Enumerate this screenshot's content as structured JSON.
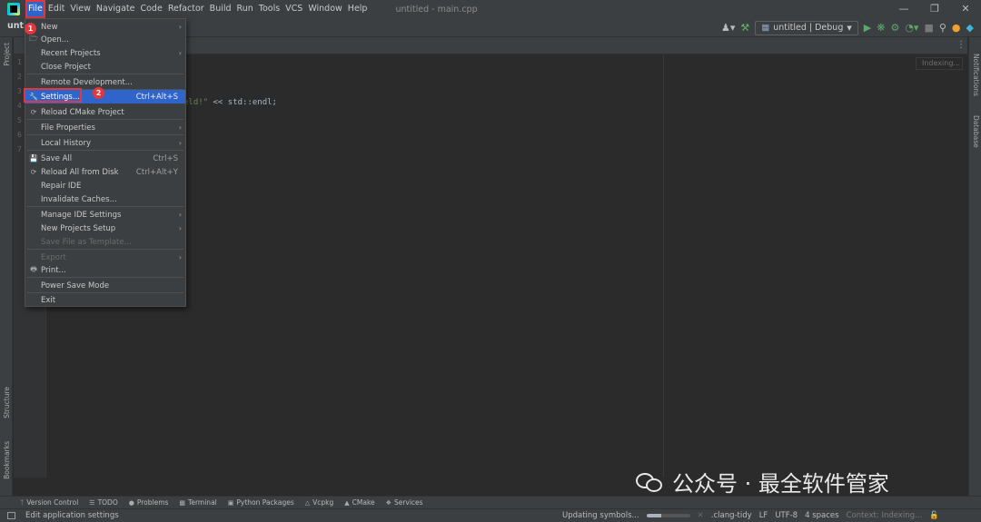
{
  "app": {
    "window_title": "untitled - main.cpp",
    "project": "untitled"
  },
  "menubar": [
    "File",
    "Edit",
    "View",
    "Navigate",
    "Code",
    "Refactor",
    "Build",
    "Run",
    "Tools",
    "VCS",
    "Window",
    "Help"
  ],
  "window_buttons": [
    "—",
    "❐",
    "✕"
  ],
  "run_config": {
    "label": "untitled | Debug"
  },
  "file_menu": {
    "items": [
      {
        "label": "New",
        "arrow": "›"
      },
      {
        "label": "Open...",
        "icon": "folder-icon"
      },
      {
        "label": "Recent Projects",
        "arrow": "›"
      },
      {
        "label": "Close Project"
      },
      {
        "label": "Remote Development..."
      },
      {
        "label": "Settings...",
        "shortcut": "Ctrl+Alt+S",
        "icon": "wrench-icon",
        "highlight": true
      },
      {
        "label": "Reload CMake Project",
        "icon": "reload-icon"
      },
      {
        "label": "File Properties",
        "arrow": "›"
      },
      {
        "label": "Local History",
        "arrow": "›"
      },
      {
        "label": "Save All",
        "shortcut": "Ctrl+S",
        "icon": "save-icon"
      },
      {
        "label": "Reload All from Disk",
        "shortcut": "Ctrl+Alt+Y",
        "icon": "reload-icon"
      },
      {
        "label": "Repair IDE"
      },
      {
        "label": "Invalidate Caches..."
      },
      {
        "label": "Manage IDE Settings",
        "arrow": "›"
      },
      {
        "label": "New Projects Setup",
        "arrow": "›"
      },
      {
        "label": "Save File as Template...",
        "disabled": true
      },
      {
        "label": "Export",
        "arrow": "›",
        "disabled": true
      },
      {
        "label": "Print...",
        "icon": "print-icon"
      },
      {
        "label": "Power Save Mode"
      },
      {
        "label": "Exit"
      }
    ]
  },
  "callouts": {
    "step1": "1",
    "step2": "2"
  },
  "editor": {
    "line_numbers": [
      "1",
      "2",
      "3",
      "4",
      "5",
      "6",
      "7"
    ],
    "code_text": "eld!\" << std::endl;",
    "code_string_part": "eld!\"",
    "code_rest": " << std::endl;",
    "indexing_label": "Indexing..."
  },
  "left_strip": {
    "project": "Project",
    "structure": "Structure",
    "bookmarks": "Bookmarks"
  },
  "right_strip": {
    "notifications": "Notifications",
    "database": "Database"
  },
  "bottom_tools": [
    {
      "label": "Version Control",
      "icon": "branch-icon"
    },
    {
      "label": "TODO",
      "icon": "list-icon"
    },
    {
      "label": "Problems",
      "icon": "problems-icon"
    },
    {
      "label": "Terminal",
      "icon": "terminal-icon"
    },
    {
      "label": "Python Packages",
      "icon": "package-icon"
    },
    {
      "label": "Vcpkg",
      "icon": "vcpkg-icon"
    },
    {
      "label": "CMake",
      "icon": "cmake-icon"
    },
    {
      "label": "Services",
      "icon": "services-icon"
    }
  ],
  "statusbar": {
    "message": "Edit application settings",
    "updating": "Updating symbols...",
    "progress": 0.35,
    "clang_tidy": ".clang-tidy",
    "line_sep": "LF",
    "encoding": "UTF-8",
    "indent": "4 spaces",
    "context": "Context: Indexing..."
  },
  "watermark": {
    "text": "公众号 · 最全软件管家"
  },
  "colors": {
    "accent": "#2f65ca",
    "callout": "#e0383e",
    "background": "#2b2b2b",
    "panel": "#3c3f41"
  }
}
